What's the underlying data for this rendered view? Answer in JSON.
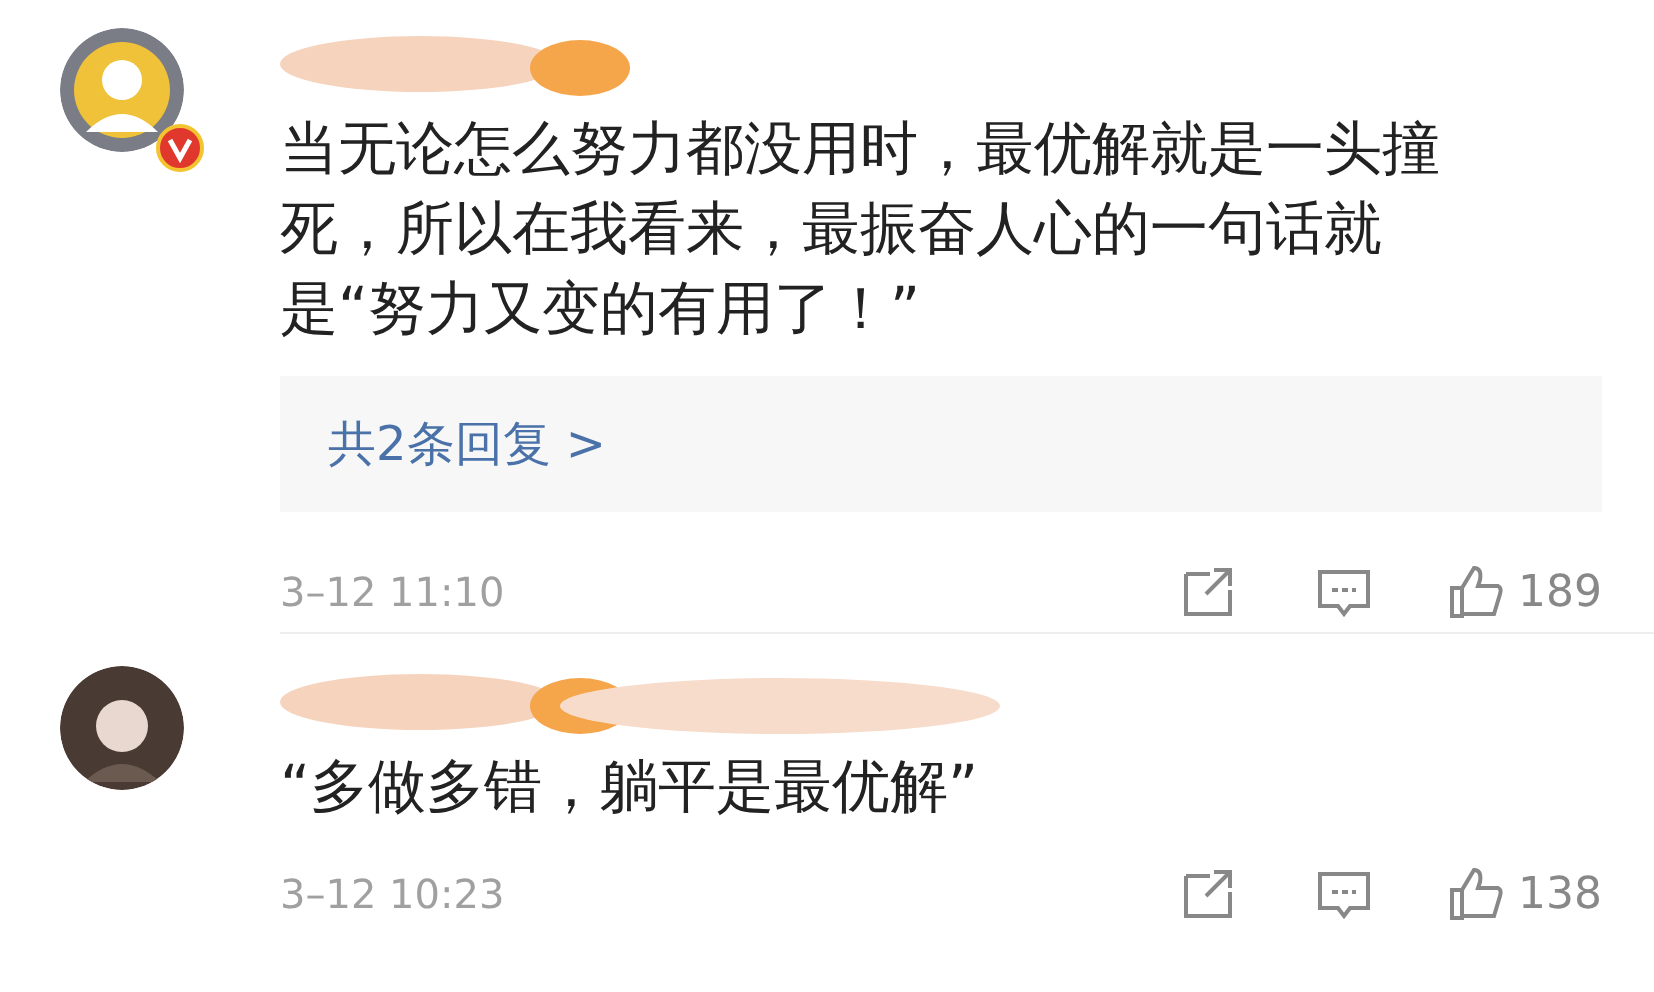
{
  "comments": [
    {
      "verified": true,
      "text": "当无论怎么努力都没用时，最优解就是一头撞死，所以在我看来，最振奋人心的一句话就是“努力又变的有用了！”",
      "replies": "共2条回复 >",
      "time": "3–12 11:10",
      "likes": "189"
    },
    {
      "verified": false,
      "text": "“多做多错，躺平是最优解”",
      "time": "3–12 10:23",
      "likes": "138"
    }
  ]
}
